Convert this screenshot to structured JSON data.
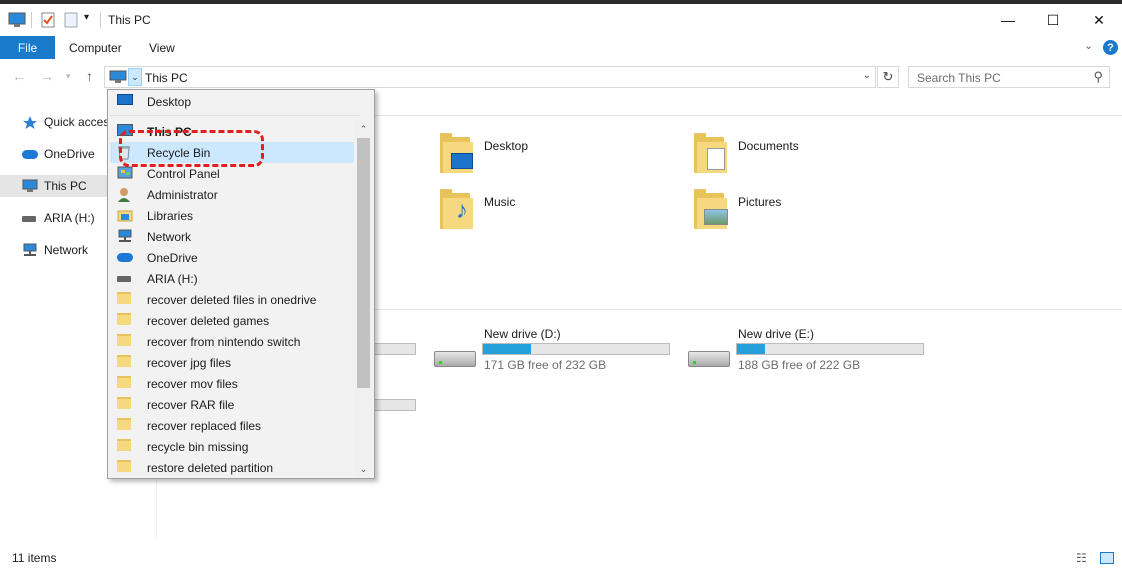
{
  "window": {
    "title": "This PC",
    "controls": {
      "minimize": "—",
      "maximize": "☐",
      "close": "✕"
    }
  },
  "ribbon": {
    "file_tab": "File",
    "tabs": [
      "Computer",
      "View"
    ]
  },
  "address": {
    "path": "This PC",
    "search_placeholder": "Search This PC"
  },
  "nav_pane": {
    "items": [
      {
        "label": "Quick access",
        "icon": "star-icon"
      },
      {
        "label": "OneDrive",
        "icon": "cloud-icon"
      },
      {
        "label": "This PC",
        "icon": "computer-icon",
        "selected": true
      },
      {
        "label": "ARIA (H:)",
        "icon": "drive-icon"
      },
      {
        "label": "Network",
        "icon": "network-icon"
      }
    ]
  },
  "folders": [
    {
      "name": "Desktop",
      "icon": "desktop-folder-icon"
    },
    {
      "name": "Documents",
      "icon": "documents-folder-icon"
    },
    {
      "name": "Music",
      "icon": "music-folder-icon"
    },
    {
      "name": "Pictures",
      "icon": "pictures-folder-icon"
    }
  ],
  "drives": [
    {
      "name": "New drive (D:)",
      "free": "171 GB free of 232 GB",
      "used_fraction": 0.26
    },
    {
      "name": "New drive (E:)",
      "free": "188 GB free of 222 GB",
      "used_fraction": 0.15
    }
  ],
  "dropdown": {
    "items": [
      {
        "label": "Desktop",
        "icon": "desktop-icon"
      },
      {
        "label": "This PC",
        "icon": "computer-icon",
        "bold": true
      },
      {
        "label": "Recycle Bin",
        "icon": "recycle-bin-icon",
        "highlighted": true
      },
      {
        "label": "Control Panel",
        "icon": "control-panel-icon"
      },
      {
        "label": "Administrator",
        "icon": "user-icon"
      },
      {
        "label": "Libraries",
        "icon": "libraries-icon"
      },
      {
        "label": "Network",
        "icon": "network-icon"
      },
      {
        "label": "OneDrive",
        "icon": "cloud-icon"
      },
      {
        "label": "ARIA (H:)",
        "icon": "drive-icon"
      },
      {
        "label": "recover deleted files in onedrive",
        "icon": "folder-icon"
      },
      {
        "label": "recover deleted games",
        "icon": "folder-icon"
      },
      {
        "label": "recover from nintendo switch",
        "icon": "folder-icon"
      },
      {
        "label": "recover jpg files",
        "icon": "folder-icon"
      },
      {
        "label": "recover mov files",
        "icon": "folder-icon"
      },
      {
        "label": "recover RAR file",
        "icon": "folder-icon"
      },
      {
        "label": "recover replaced files",
        "icon": "folder-icon"
      },
      {
        "label": "recycle bin missing",
        "icon": "folder-icon"
      },
      {
        "label": "restore deleted partition",
        "icon": "folder-icon"
      }
    ]
  },
  "status": {
    "item_count": "11 items"
  },
  "colors": {
    "accent": "#1979ca",
    "highlight": "#cce8ff",
    "callout": "#e02020",
    "drive_bar": "#26a0da"
  }
}
